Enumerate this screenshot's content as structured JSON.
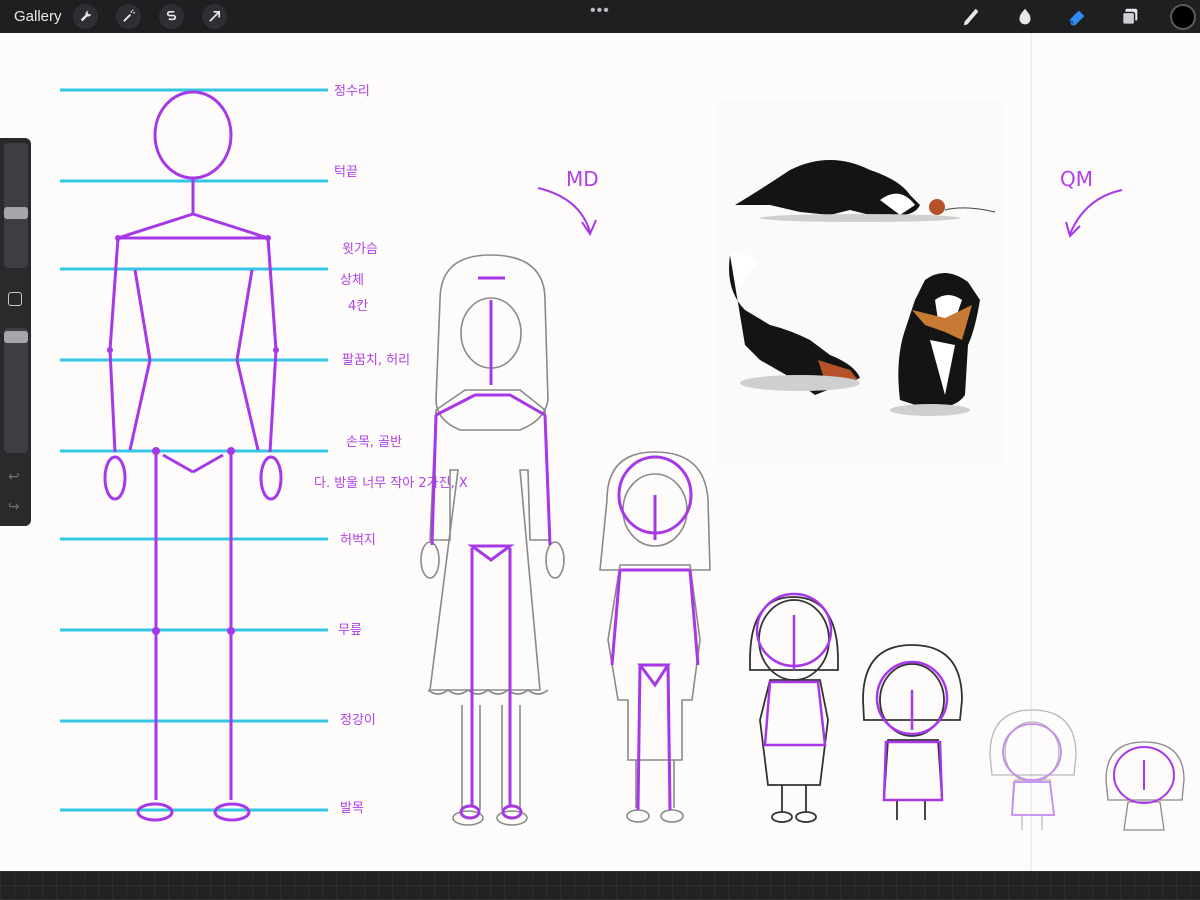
{
  "app": {
    "gallery_label": "Gallery",
    "more_label": "•••",
    "colors": {
      "guide_cyan": "#35c6e6",
      "sketch_purple": "#a638e8",
      "pencil_gray": "#8a8a8a",
      "canvas": "#fdfcfa",
      "eraser_active": "#2f8cf0",
      "current_color": "#000000"
    }
  },
  "toolbar": {
    "left_tools": [
      {
        "name": "wrench-icon",
        "label": "Actions"
      },
      {
        "name": "magic-wand-icon",
        "label": "Adjustments"
      },
      {
        "name": "selection-s-icon",
        "label": "Selection"
      },
      {
        "name": "arrow-cursor-icon",
        "label": "Transform"
      }
    ],
    "right_tools": [
      {
        "name": "brush-icon",
        "label": "Paint"
      },
      {
        "name": "smudge-icon",
        "label": "Smudge"
      },
      {
        "name": "eraser-icon",
        "label": "Erase",
        "active": true
      },
      {
        "name": "layers-icon",
        "label": "Layers"
      }
    ]
  },
  "canvas_annotations": {
    "head_top": "정수리",
    "chin": "턱끝",
    "shoulder": "윗가슴",
    "chest": "상체",
    "chest2": "4칸",
    "elbow": "팔꿈치, 허리",
    "wrist": "손목, 골반",
    "crotch_note": "다. 방울  너무 작아 2가진, X",
    "thigh": "허벅지",
    "knee": "무릎",
    "shin": "정강이",
    "foot": "발목",
    "label_md": "MD",
    "label_qm": "QM"
  },
  "layer_sidebar": {
    "brush_size_fraction": 0.55,
    "opacity_fraction": 0.93
  }
}
